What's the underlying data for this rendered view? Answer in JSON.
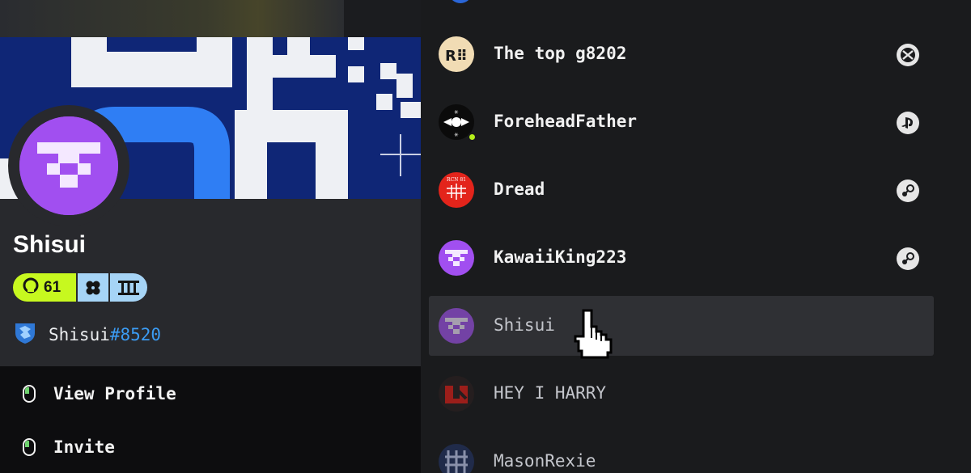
{
  "profile": {
    "name": "Shisui",
    "level": "61",
    "handle_name": "Shisui",
    "handle_tag": "#8520",
    "menu": [
      {
        "label": "View Profile",
        "icon": "mouse-left-click-icon"
      },
      {
        "label": "Invite",
        "icon": "mouse-left-click-icon"
      }
    ],
    "colors": {
      "level_badge": "#c7f81f",
      "rank_badge": "#a6d4f6",
      "banner": "#0f2676",
      "avatar": "#a14ff0",
      "tag": "#3b9cf4"
    }
  },
  "friends": [
    {
      "name": "The top g8202",
      "platform": "xbox-icon",
      "online": false,
      "active": false,
      "avatar": "rl-logo"
    },
    {
      "name": "ForeheadFather",
      "platform": "playstation-icon",
      "online": true,
      "active": false,
      "avatar": "sparkle-eye"
    },
    {
      "name": "Dread",
      "platform": "steam-icon",
      "online": false,
      "active": false,
      "avatar": "red-circuit"
    },
    {
      "name": "KawaiiKing223",
      "platform": "steam-icon",
      "online": false,
      "active": false,
      "avatar": "purple-glyph"
    },
    {
      "name": "Shisui",
      "platform": "",
      "online": false,
      "active": true,
      "avatar": "purple-glyph"
    },
    {
      "name": "HEY I HARRY",
      "platform": "",
      "online": false,
      "active": false,
      "avatar": "red-u-logo"
    },
    {
      "name": "MasonRexie",
      "platform": "",
      "online": false,
      "active": false,
      "avatar": "grid-glyph"
    }
  ]
}
